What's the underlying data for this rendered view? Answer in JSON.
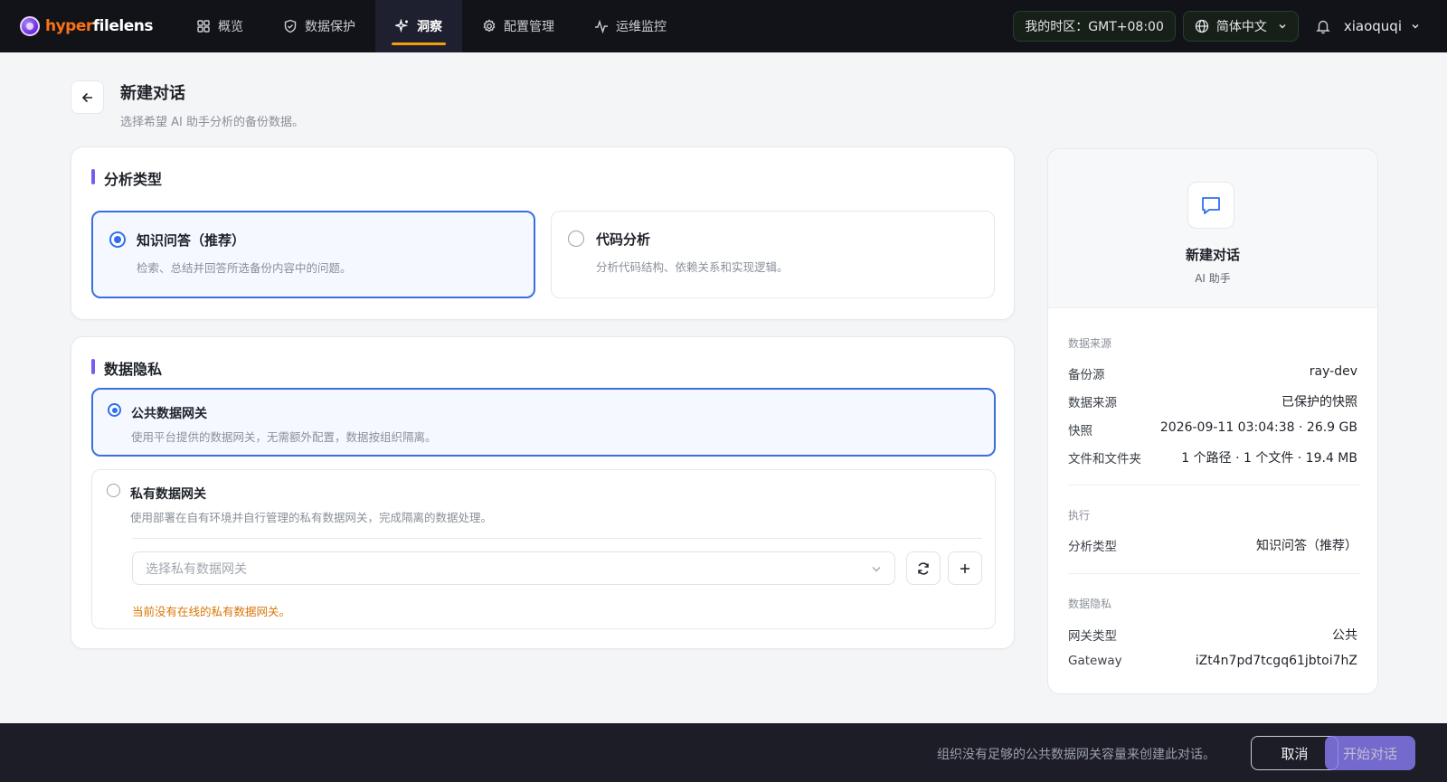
{
  "app": {
    "logo_part1": "hyper",
    "logo_part2": "filelens",
    "brand_color": "#f97316"
  },
  "nav": {
    "items": [
      {
        "label": "概览",
        "icon": "dashboard-icon"
      },
      {
        "label": "数据保护",
        "icon": "shield-icon"
      },
      {
        "label": "洞察",
        "icon": "sparkle-icon"
      },
      {
        "label": "配置管理",
        "icon": "gear-icon"
      },
      {
        "label": "运维监控",
        "icon": "activity-icon"
      }
    ],
    "active_index": 2
  },
  "topbar": {
    "timezone": "我的时区：GMT+08:00",
    "language": "简体中文",
    "username": "xiaoquqi"
  },
  "page": {
    "title": "新建对话",
    "subtitle": "选择希望 AI 助手分析的备份数据。"
  },
  "analysis": {
    "section_title": "分析类型",
    "options": [
      {
        "title": "知识问答（推荐）",
        "desc": "检索、总结并回答所选备份内容中的问题。",
        "selected": true
      },
      {
        "title": "代码分析",
        "desc": "分析代码结构、依赖关系和实现逻辑。",
        "selected": false
      }
    ]
  },
  "privacy": {
    "section_title": "数据隐私",
    "public": {
      "title": "公共数据网关",
      "desc": "使用平台提供的数据网关，无需额外配置，数据按组织隔离。",
      "selected": true
    },
    "private": {
      "title": "私有数据网关",
      "desc": "使用部署在自有环境并自行管理的私有数据网关，完成隔离的数据处理。",
      "selected": false,
      "select_placeholder": "选择私有数据网关",
      "warning": "当前没有在线的私有数据网关。"
    }
  },
  "summary": {
    "name": "新建对话",
    "role": "AI 助手",
    "source_label": "数据来源",
    "source_rows": [
      {
        "k": "备份源",
        "v": "ray-dev"
      },
      {
        "k": "数据来源",
        "v": "已保护的快照"
      },
      {
        "k": "快照",
        "v": "2026-09-11 03:04:38 · 26.9 GB"
      },
      {
        "k": "文件和文件夹",
        "v": "1 个路径 · 1 个文件 · 19.4 MB"
      }
    ],
    "exec_label": "执行",
    "exec_rows": [
      {
        "k": "分析类型",
        "v": "知识问答（推荐）"
      }
    ],
    "privacy_label": "数据隐私",
    "privacy_rows": [
      {
        "k": "网关类型",
        "v": "公共"
      },
      {
        "k": "Gateway",
        "v": "iZt4n7pd7tcgq61jbtoi7hZ"
      }
    ]
  },
  "footer": {
    "message": "组织没有足够的公共数据网关容量来创建此对话。",
    "cancel_label": "取消",
    "start_label": "开始对话"
  },
  "colors": {
    "accent": "#7c5cf0",
    "selected_border": "#3b6fe0",
    "warning": "#d97706"
  }
}
